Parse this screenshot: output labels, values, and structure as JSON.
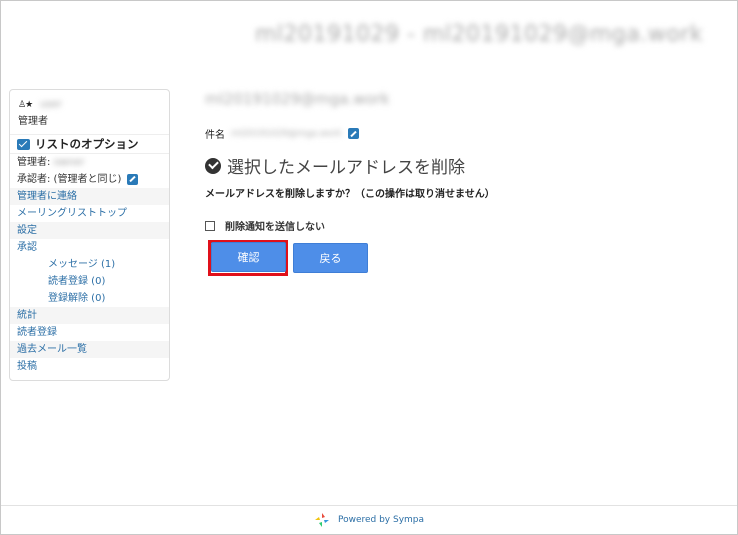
{
  "header": {
    "title": "ml20191029 - ml20191029@mga.work"
  },
  "sidebar": {
    "user_name": "user",
    "user_role": "管理者",
    "options_title": "リストのオプション",
    "owner_label": "管理者:",
    "owner_value": "owner",
    "moderator_label": "承認者: (管理者と同じ)",
    "contact_owner": "管理者に連絡",
    "list_top": "メーリングリストトップ",
    "settings": "設定",
    "approval": "承認",
    "messages": "メッセージ (1)",
    "subscriptions": "読者登録 (0)",
    "unsubscriptions": "登録解除 (0)",
    "stats": "統計",
    "subscribers": "読者登録",
    "archives": "過去メール一覧",
    "post": "投稿"
  },
  "main": {
    "email": "ml20191029@mga.work",
    "subject_label": "件名",
    "subject_value": "ml20191029@mga.work",
    "title": "選択したメールアドレスを削除",
    "question": "メールアドレスを削除しますか？（この操作は取り消せません）",
    "checkbox_label": "削除通知を送信しない",
    "confirm_button": "確認",
    "back_button": "戻る"
  },
  "footer": {
    "text": "Powered by Sympa"
  },
  "colors": {
    "accent": "#4e8ee8",
    "link": "#2c6fa6",
    "highlight": "#e0101a"
  }
}
